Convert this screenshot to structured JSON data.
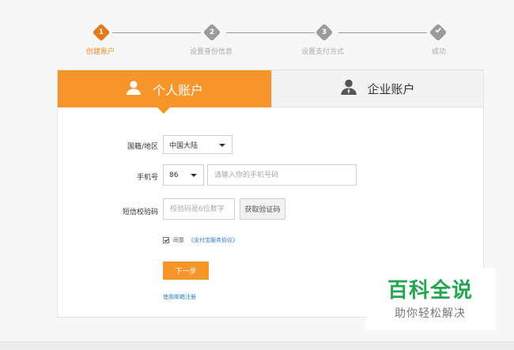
{
  "stepper": {
    "steps": [
      {
        "num": "1",
        "label": "创建账户"
      },
      {
        "num": "2",
        "label": "设置身份信息"
      },
      {
        "num": "3",
        "label": "设置支付方式"
      },
      {
        "num": "",
        "label": "成功"
      }
    ]
  },
  "tabs": {
    "personal": "个人账户",
    "business": "企业账户"
  },
  "form": {
    "region_label": "国籍/地区",
    "region_value": "中国大陆",
    "phone_label": "手机号",
    "country_code": "86",
    "phone_placeholder": "请输入你的手机号码",
    "code_label": "短信校验码",
    "code_placeholder": "校验码是6位数字",
    "get_code_button": "获取验证码",
    "agree_text": "同意",
    "agree_link": "《支付宝服务协议》",
    "next_button": "下一步",
    "email_register_link": "使用邮箱注册"
  },
  "watermark": {
    "title": "百科全说",
    "subtitle": "助你轻松解决"
  },
  "colors": {
    "accent": "#f6962a",
    "step_active": "#e8791a",
    "step_inactive": "#9b9b9b",
    "link": "#2e7bd0",
    "watermark_green": "#22a650"
  },
  "icons": [
    "person-icon",
    "business-person-icon",
    "check-icon",
    "caret-down-icon"
  ]
}
